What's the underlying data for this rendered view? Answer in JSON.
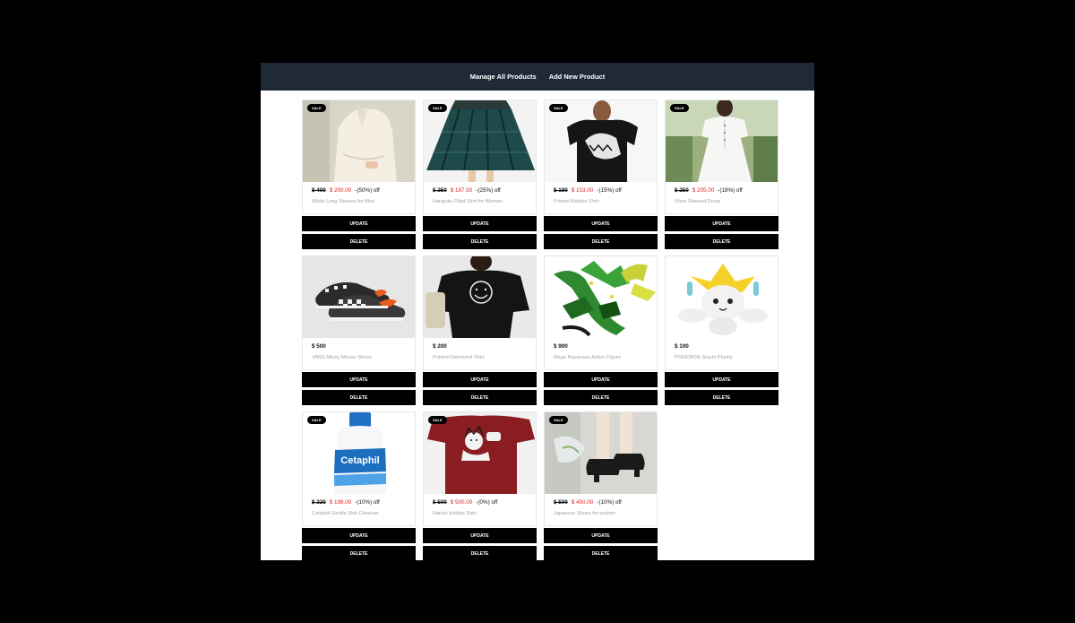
{
  "nav": {
    "manage": "Manage All Products",
    "add": "Add New Product"
  },
  "buttons": {
    "update": "UPDATE",
    "delete": "DELETE"
  },
  "badge": "SALE",
  "products": [
    {
      "name": "White Long Sleeves for Men",
      "old_price": "$ 400",
      "new_price": "$ 200.00",
      "discount": "-(50%) off",
      "sale": true
    },
    {
      "name": "Harajuku Plaid Skirt for Women",
      "old_price": "$ 250",
      "new_price": "$ 187.50",
      "discount": "-(25%) off",
      "sale": true
    },
    {
      "name": "Printed Kiddies Shirt",
      "old_price": "$ 180",
      "new_price": "$ 153.00",
      "discount": "-(15%) off",
      "sale": true
    },
    {
      "name": "Short Sleeved Dress",
      "old_price": "$ 250",
      "new_price": "$ 205.00",
      "discount": "-(18%) off",
      "sale": true
    },
    {
      "name": "VANS Miney Mouse Shoes",
      "price": "$ 500",
      "sale": false
    },
    {
      "name": "Printed Oversized Shirt",
      "price": "$ 200",
      "sale": false
    },
    {
      "name": "Mega Rayquaza Action Figure",
      "price": "$ 900",
      "sale": false
    },
    {
      "name": "POKEMON Jirachi Plushy",
      "price": "$ 100",
      "sale": false
    },
    {
      "name": "Cetaphil Gentle Skin Cleanser",
      "old_price": "$ 220",
      "new_price": "$ 198.00",
      "discount": "-(10%) off",
      "sale": true,
      "label": "Cetaphil"
    },
    {
      "name": "Naruto kiddies Shirt",
      "old_price": "$ 500",
      "new_price": "$ 500.00",
      "discount": "-(0%) off",
      "sale": true
    },
    {
      "name": "Japanese Shoes for women",
      "old_price": "$ 500",
      "new_price": "$ 450.00",
      "discount": "-(10%) off",
      "sale": true
    }
  ]
}
